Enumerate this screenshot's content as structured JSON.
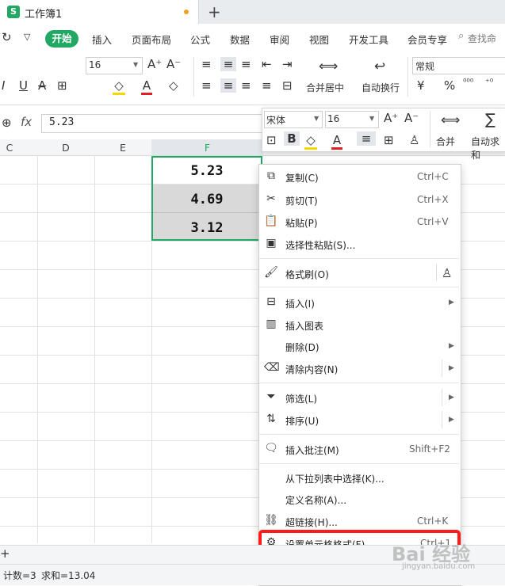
{
  "title_bar": {
    "doc_title": "工作簿1",
    "new_tab": "+"
  },
  "menu": {
    "home": "开始",
    "items": [
      "插入",
      "页面布局",
      "公式",
      "数据",
      "审阅",
      "视图",
      "开发工具",
      "会员专享"
    ],
    "search": "查找命"
  },
  "ribbon": {
    "font_size": "16",
    "merge_center": "合并居中",
    "wrap_text": "自动换行",
    "number_format": "常规",
    "currency_symbol": "¥",
    "percent_symbol": "%"
  },
  "formula_bar": {
    "fx_label": "fx",
    "value": "5.23"
  },
  "columns": [
    "C",
    "D",
    "E",
    "F"
  ],
  "cells": {
    "f1": "5.23",
    "f2": "4.69",
    "f3": "3.12"
  },
  "mini_toolbar": {
    "font_name": "宋体",
    "font_size": "16",
    "merge_label": "合并",
    "autosum_label": "自动求和"
  },
  "context_menu": {
    "copy": {
      "label": "复制(C)",
      "shortcut": "Ctrl+C"
    },
    "cut": {
      "label": "剪切(T)",
      "shortcut": "Ctrl+X"
    },
    "paste": {
      "label": "粘贴(P)",
      "shortcut": "Ctrl+V"
    },
    "paste_special": {
      "label": "选择性粘贴(S)..."
    },
    "format_painter": {
      "label": "格式刷(O)"
    },
    "insert": {
      "label": "插入(I)"
    },
    "insert_chart": {
      "label": "插入图表"
    },
    "delete": {
      "label": "删除(D)"
    },
    "clear": {
      "label": "清除内容(N)"
    },
    "filter": {
      "label": "筛选(L)"
    },
    "sort": {
      "label": "排序(U)"
    },
    "insert_comment": {
      "label": "插入批注(M)",
      "shortcut": "Shift+F2"
    },
    "pick_from_list": {
      "label": "从下拉列表中选择(K)..."
    },
    "define_name": {
      "label": "定义名称(A)..."
    },
    "hyperlink": {
      "label": "超链接(H)...",
      "shortcut": "Ctrl+K"
    },
    "format_cells": {
      "label": "设置单元格格式(F)...",
      "shortcut": "Ctrl+1"
    }
  },
  "status_bar": {
    "count": "计数=3",
    "sum": "求和=13.04"
  },
  "watermark": {
    "text": "Bai 经验",
    "sub": "jingyan.baidu.com"
  },
  "colors": {
    "accent": "#21a862",
    "highlight": "#ff1a1a"
  }
}
